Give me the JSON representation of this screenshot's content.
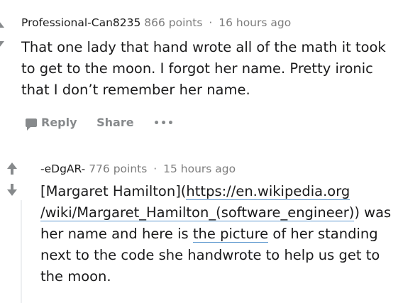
{
  "comment1": {
    "author": "Professional-Can8235",
    "points": "866 points",
    "separator": "·",
    "time": "16 hours ago",
    "body_lines": [
      "That one lady that hand wrote all of the math it took",
      "to get to the moon. I forgot her name. Pretty ironic",
      "that I don’t remember her name."
    ],
    "actions": {
      "reply": "Reply",
      "share": "Share",
      "more": "•••"
    }
  },
  "comment2": {
    "author": "-eDgAR-",
    "points": "776 points",
    "separator": "·",
    "time": "15 hours ago",
    "body": {
      "line1_text": "[Margaret Hamilton](",
      "line1_link": "https://en.wikipedia.org",
      "line2_link": "/wiki/Margaret_Hamilton_(software_engineer)",
      "line2_text": ") was",
      "line3_before": "her name and here is ",
      "line3_link": "the picture",
      "line3_after": " of her standing",
      "line4": "next to the code she handwrote to help us get to",
      "line5": "the moon."
    }
  },
  "icons": {
    "upvote": "upvote-arrow-icon",
    "downvote": "downvote-arrow-icon",
    "reply": "comment-bubble-icon"
  }
}
